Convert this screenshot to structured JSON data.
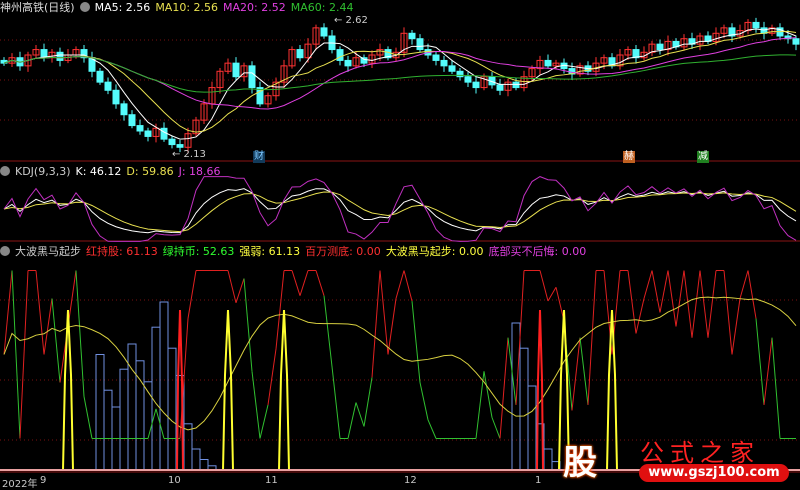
{
  "main": {
    "title": "神州高铁(日线)",
    "ma5": "MA5: 2.56",
    "ma10": "MA10: 2.56",
    "ma20": "MA20: 2.52",
    "ma60": "MA60: 2.44",
    "high_label": "2.62",
    "low_label": "2.13",
    "tags": [
      "财",
      "赫",
      "减"
    ]
  },
  "kdj": {
    "title": "KDJ(9,3,3)",
    "k": "K: 46.12",
    "d": "D: 59.86",
    "j": "J: 18.66"
  },
  "ind": {
    "title": "大波黑马起步",
    "red": "红持股: 61.13",
    "green": "绿持币: 52.63",
    "strength": "强弱: 61.13",
    "bottom": "百万测底: 0.00",
    "start": "大波黑马起步: 0.00",
    "noregret": "底部买不后悔: 0.00"
  },
  "axis": {
    "ticks": [
      "2022年",
      "9",
      "10",
      "11",
      "12",
      "1"
    ]
  },
  "logo": {
    "badge": "股",
    "name": "公式之家",
    "url": "www.gszj100.com"
  },
  "colors": {
    "up": "#ff3232",
    "down": "#54fcfc",
    "ma5": "#ffffff",
    "ma10": "#e8e050",
    "ma20": "#e040e0",
    "ma60": "#30b030",
    "grid": "#7a1010"
  },
  "chart_data": {
    "type": "candlestick",
    "price_range": [
      2.13,
      2.62
    ],
    "closes": [
      2.45,
      2.47,
      2.44,
      2.48,
      2.5,
      2.47,
      2.49,
      2.46,
      2.48,
      2.5,
      2.47,
      2.42,
      2.38,
      2.35,
      2.3,
      2.26,
      2.22,
      2.2,
      2.18,
      2.21,
      2.17,
      2.15,
      2.14,
      2.19,
      2.24,
      2.3,
      2.36,
      2.42,
      2.45,
      2.4,
      2.44,
      2.36,
      2.3,
      2.33,
      2.38,
      2.44,
      2.5,
      2.47,
      2.52,
      2.58,
      2.55,
      2.5,
      2.46,
      2.44,
      2.47,
      2.45,
      2.48,
      2.5,
      2.47,
      2.49,
      2.56,
      2.54,
      2.5,
      2.48,
      2.46,
      2.44,
      2.42,
      2.4,
      2.38,
      2.36,
      2.4,
      2.37,
      2.35,
      2.38,
      2.36,
      2.4,
      2.43,
      2.46,
      2.44,
      2.45,
      2.43,
      2.41,
      2.44,
      2.42,
      2.45,
      2.47,
      2.44,
      2.48,
      2.5,
      2.47,
      2.49,
      2.52,
      2.5,
      2.53,
      2.51,
      2.54,
      2.52,
      2.55,
      2.53,
      2.56,
      2.58,
      2.55,
      2.57,
      2.6,
      2.58,
      2.56,
      2.58,
      2.55,
      2.54,
      2.52
    ],
    "yellow_signals": [
      8,
      28,
      35,
      70,
      76
    ],
    "red_signals": [
      22,
      67
    ],
    "blue_bars": [
      [
        12,
        55
      ],
      [
        13,
        38
      ],
      [
        14,
        30
      ],
      [
        15,
        48
      ],
      [
        16,
        60
      ],
      [
        17,
        52
      ],
      [
        18,
        42
      ],
      [
        19,
        68
      ],
      [
        20,
        80
      ],
      [
        21,
        58
      ],
      [
        22,
        45
      ],
      [
        23,
        22
      ],
      [
        24,
        10
      ],
      [
        25,
        5
      ],
      [
        26,
        2
      ],
      [
        64,
        70
      ],
      [
        65,
        58
      ],
      [
        66,
        40
      ],
      [
        67,
        22
      ],
      [
        68,
        10
      ],
      [
        69,
        4
      ]
    ]
  }
}
